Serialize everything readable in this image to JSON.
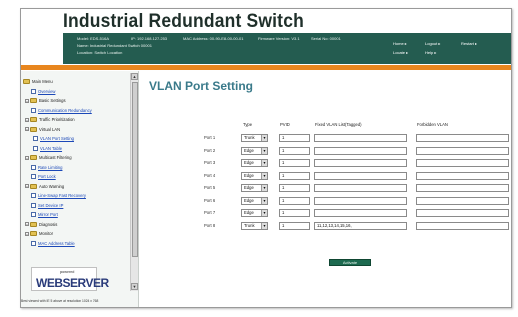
{
  "header": {
    "title": "Industrial Redundant Switch",
    "info": {
      "line1_a": "Model: EDS-516A",
      "line1_b": "IP: 192.168.127.253",
      "line1_c": "MAC Address: 00-90-E8-00-00-01",
      "line1_d": "Firmware Version: V3.1",
      "line1_e": "Serial No: 00001",
      "line2": "Name: Industrial Redundant Switch 00001",
      "line3": "Location: Switch Location"
    },
    "nav": {
      "home": "Home",
      "logout": "Logout",
      "restart": "Restart",
      "locate": "Locate",
      "help": "Help"
    }
  },
  "sidebar": {
    "items": [
      {
        "label": "Main Menu",
        "kind": "root"
      },
      {
        "label": "Overview",
        "kind": "link"
      },
      {
        "label": "Basic Settings",
        "kind": "folder"
      },
      {
        "label": "Communication Redundancy",
        "kind": "link"
      },
      {
        "label": "Traffic Prioritization",
        "kind": "folder"
      },
      {
        "label": "Virtual LAN",
        "kind": "folder"
      },
      {
        "label": "VLAN Port Setting",
        "kind": "link"
      },
      {
        "label": "VLAN Table",
        "kind": "link"
      },
      {
        "label": "Multicast Filtering",
        "kind": "folder"
      },
      {
        "label": "Rate Limiting",
        "kind": "link"
      },
      {
        "label": "Port Lock",
        "kind": "link"
      },
      {
        "label": "Auto Warning",
        "kind": "folder"
      },
      {
        "label": "Line-Swap Fast Recovery",
        "kind": "link"
      },
      {
        "label": "Set Device IP",
        "kind": "link"
      },
      {
        "label": "Mirror Port",
        "kind": "link"
      },
      {
        "label": "Diagnosis",
        "kind": "folder"
      },
      {
        "label": "Monitor",
        "kind": "folder"
      },
      {
        "label": "MAC Address Table",
        "kind": "link"
      }
    ],
    "logo_small": "powered",
    "logo_main": "WEBSERVER",
    "footer": "Best viewed with IE 5 above at resolution 1024 x 768"
  },
  "main": {
    "title": "VLAN Port Setting",
    "columns": {
      "type": "Type",
      "pvid": "PVID",
      "tagged": "Fixed VLAN List(Tagged)",
      "forbidden": "Forbidden VLAN"
    },
    "rows": [
      {
        "port": "Port 1",
        "type": "Trunk",
        "pvid": "1",
        "tagged": "",
        "forbidden": ""
      },
      {
        "port": "Port 2",
        "type": "Edge",
        "pvid": "1",
        "tagged": "",
        "forbidden": ""
      },
      {
        "port": "Port 3",
        "type": "Edge",
        "pvid": "1",
        "tagged": "",
        "forbidden": ""
      },
      {
        "port": "Port 4",
        "type": "Edge",
        "pvid": "1",
        "tagged": "",
        "forbidden": ""
      },
      {
        "port": "Port 5",
        "type": "Edge",
        "pvid": "1",
        "tagged": "",
        "forbidden": ""
      },
      {
        "port": "Port 6",
        "type": "Edge",
        "pvid": "1",
        "tagged": "",
        "forbidden": ""
      },
      {
        "port": "Port 7",
        "type": "Edge",
        "pvid": "1",
        "tagged": "",
        "forbidden": ""
      },
      {
        "port": "Port 8",
        "type": "Trunk",
        "pvid": "1",
        "tagged": "11,12,13,14,15,16,",
        "forbidden": ""
      }
    ],
    "activate_label": "Activate"
  },
  "colors": {
    "header_bar": "#245c50",
    "accent_orange": "#e8861e",
    "title_teal": "#3a7a8a",
    "button_green": "#1d6a50"
  }
}
